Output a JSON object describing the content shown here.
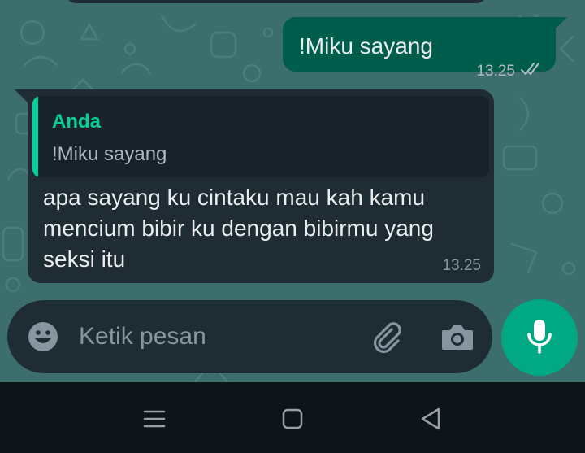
{
  "colors": {
    "chat_bg": "#3c6e6e",
    "outgoing_bubble": "#005c4b",
    "incoming_bubble": "#1f2c33",
    "accent": "#00a884",
    "quote_author": "#06cf9c",
    "read_ticks": "#aebac1",
    "navbar_bg": "#0e1417"
  },
  "messages": {
    "outgoing": {
      "text": "!Miku sayang",
      "time": "13.25",
      "status_icon": "double-check-icon"
    },
    "incoming": {
      "quote_author": "Anda",
      "quote_text": "!Miku sayang",
      "text": "apa sayang ku cintaku mau kah kamu mencium bibir ku dengan bibirmu yang seksi itu",
      "time": "13.25"
    }
  },
  "composer": {
    "placeholder": "Ketik pesan",
    "value": "",
    "emoji_icon": "emoji-icon",
    "attach_icon": "paperclip-icon",
    "camera_icon": "camera-icon",
    "mic_icon": "microphone-icon"
  },
  "navbar": {
    "buttons": [
      "menu-icon",
      "home-icon",
      "back-icon"
    ]
  }
}
